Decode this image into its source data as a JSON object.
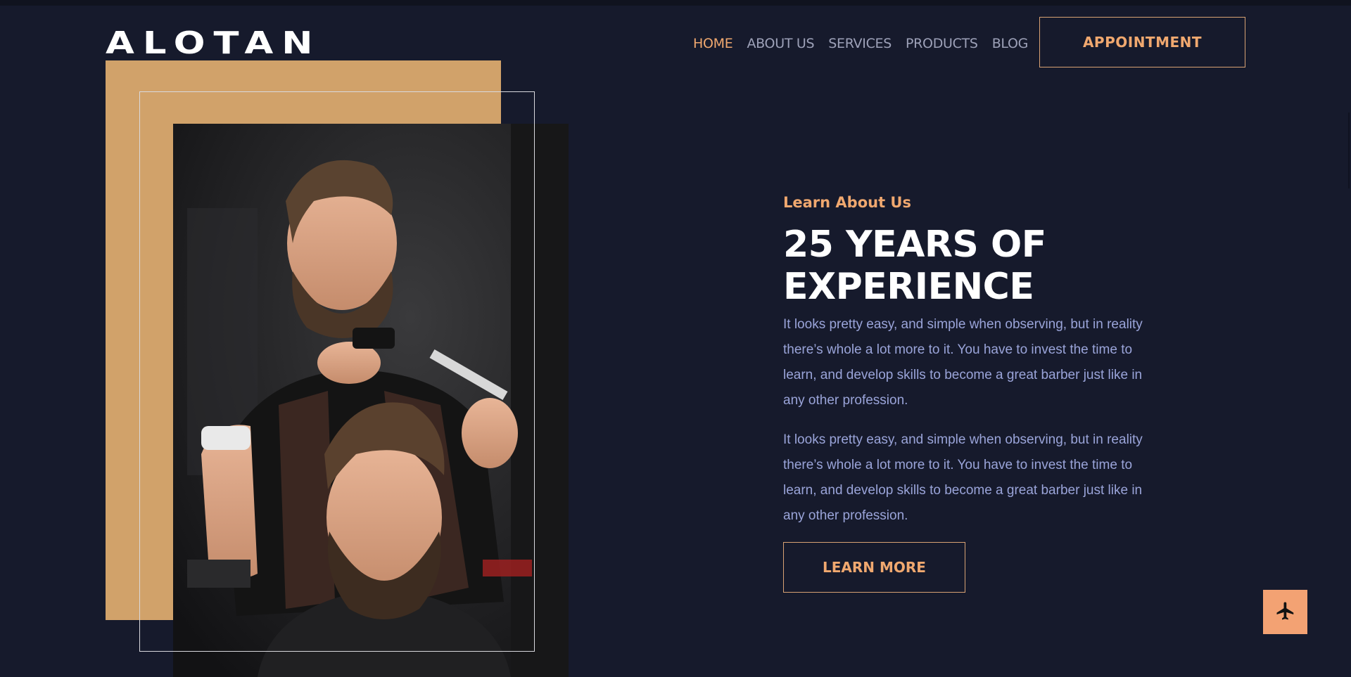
{
  "brand": {
    "logo_text": "ALOTAN"
  },
  "nav": {
    "items": [
      {
        "label": "HOME",
        "active": true
      },
      {
        "label": "ABOUT US",
        "active": false
      },
      {
        "label": "SERVICES",
        "active": false
      },
      {
        "label": "PRODUCTS",
        "active": false
      },
      {
        "label": "BLOG",
        "active": false
      }
    ],
    "cta_label": "APPOINTMENT"
  },
  "about": {
    "eyebrow": "Learn About Us",
    "headline_line1": "25 YEARS OF",
    "headline_line2": "EXPERIENCE",
    "paragraphs": [
      "It looks pretty easy, and simple when observing, but in reality there’s whole a lot more to it. You have to invest the time to learn, and develop skills to become a great barber just like in any other profession.",
      "It looks pretty easy, and simple when observing, but in reality there’s whole a lot more to it. You have to invest the time to learn, and develop skills to become a great barber just like in any other profession."
    ],
    "button_label": "LEARN MORE"
  },
  "floating_button": {
    "icon": "airplane-icon"
  },
  "colors": {
    "background": "#161a2c",
    "accent": "#f0a86f",
    "tan": "#d1a26a",
    "body_text": "#9aa4d9",
    "nav_text": "#9da1b8"
  }
}
